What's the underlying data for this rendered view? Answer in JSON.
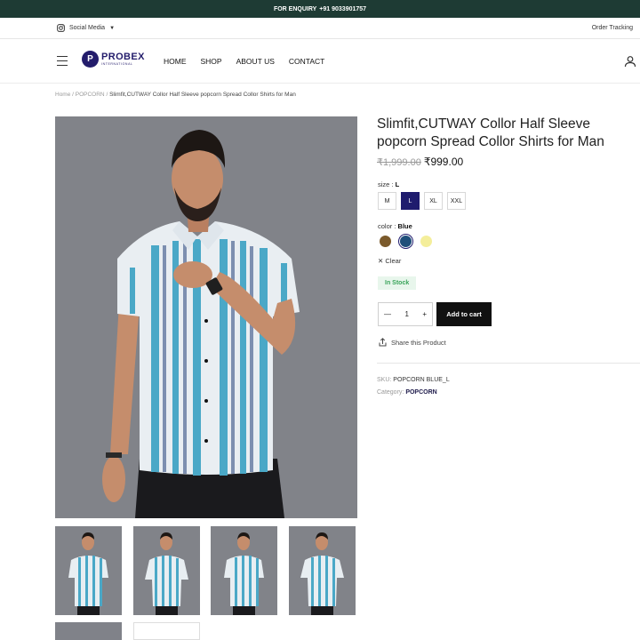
{
  "topbar": {
    "text": "FOR ENQUIRY",
    "phone": "+91 9033901757"
  },
  "utilbar": {
    "social_label": "Social Media",
    "order_tracking": "Order Tracking"
  },
  "header": {
    "logo_name": "PROBEX",
    "logo_sub": "INTERNATIONAL",
    "nav": [
      {
        "label": "HOME"
      },
      {
        "label": "SHOP"
      },
      {
        "label": "ABOUT US"
      },
      {
        "label": "CONTACT"
      }
    ]
  },
  "breadcrumb": {
    "home": "Home",
    "sep": " / ",
    "category": "POPCORN",
    "current": "Slimfit,CUTWAY Collor Half Sleeve popcorn Spread Collor Shirts for Man"
  },
  "product": {
    "title": "Slimfit,CUTWAY Collor Half Sleeve popcorn Spread Collor Shirts for Man",
    "old_price": "₹1,999.00",
    "new_price": "₹999.00",
    "size_label": "size :",
    "size_selected": "L",
    "sizes": [
      "M",
      "L",
      "XL",
      "XXL"
    ],
    "color_label": "color :",
    "color_selected": "Blue",
    "colors": [
      "#7b5a2c",
      "#1f4f7a",
      "#f4ee9b"
    ],
    "clear_label": "Clear",
    "stock": "In Stock",
    "quantity": "1",
    "add_to_cart": "Add to cart",
    "share": "Share this Product",
    "sku_label": "SKU:",
    "sku": "POPCORN BLUE_L",
    "category_label": "Category:",
    "category": "POPCORN"
  },
  "colors": {
    "topbar": "#1e3b34",
    "accent": "#1f1c6e",
    "stock_bg": "#e8f6ec",
    "stock_text": "#3aa55b"
  }
}
